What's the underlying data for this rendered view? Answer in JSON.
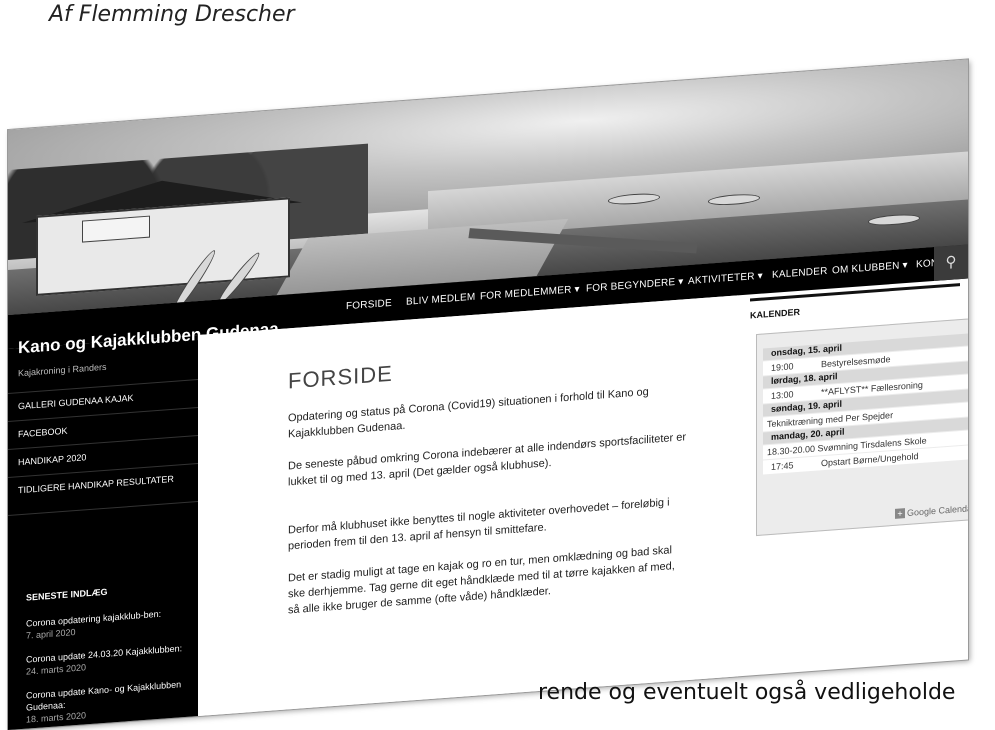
{
  "article": {
    "byline": "Af Flemming Drescher",
    "footer_text": "rende og eventuelt også vedligeholde"
  },
  "site": {
    "title": "Kano og Kajakklubben Gudenaa",
    "tagline": "Kajakroning i Randers"
  },
  "menu": {
    "items": [
      "FORSIDE",
      "BLIV MEDLEM",
      "FOR MEDLEMMER ▾",
      "FOR BEGYNDERE ▾",
      "AKTIVITETER ▾",
      "KALENDER",
      "OM KLUBBEN ▾",
      "KONTAKT"
    ],
    "search_icon": "search-icon"
  },
  "sidebar": {
    "links": [
      "GALLERI GUDENAA KAJAK",
      "FACEBOOK",
      "HANDIKAP 2020",
      "TIDLIGERE HANDIKAP RESULTATER"
    ],
    "recent_heading": "SENESTE INDLÆG",
    "recent_posts": [
      {
        "title": "Corona opdatering kajakklub-ben:",
        "date": "7. april 2020"
      },
      {
        "title": "Corona update 24.03.20 Kajakklubben:",
        "date": "24. marts 2020"
      },
      {
        "title": "Corona update Kano- og Kajakklubben Gudenaa:",
        "date": "18. marts 2020"
      }
    ]
  },
  "main": {
    "title": "FORSIDE",
    "paragraphs": [
      "Opdatering og status på Corona (Covid19) situationen i forhold til Kano og Kajakklubben Gudenaa.",
      "De seneste påbud omkring Corona indebærer at alle indendørs sportsfaciliteter er lukket til og med 13. april (Det gælder også klubhuse).",
      "Derfor må klubhuset ikke benyttes til nogle aktiviteter overhovedet – foreløbig i perioden frem til den 13. april af hensyn til smittefare.",
      "Det er stadig muligt at tage en kajak og ro en tur, men omklædning og bad skal ske derhjemme. Tag gerne dit eget håndklæde med til at tørre kajakken af med, så alle ikke bruger de samme (ofte våde) håndklæder."
    ]
  },
  "calendar": {
    "label": "KALENDER",
    "days": [
      {
        "day": "onsdag, 15. april",
        "events": [
          {
            "time": "19:00",
            "title": "Bestyrelsesmøde"
          }
        ]
      },
      {
        "day": "lørdag, 18. april",
        "events": [
          {
            "time": "13:00",
            "title": "**AFLYST** Fællesroning"
          }
        ]
      },
      {
        "day": "søndag, 19. april",
        "events": [
          {
            "time": "",
            "title": "Tekniktræning med Per Spejder"
          }
        ]
      },
      {
        "day": "mandag, 20. april",
        "events": [
          {
            "time": "",
            "title": "18.30-20.00 Svømning Tirsdalens Skole"
          },
          {
            "time": "17:45",
            "title": "Opstart Børne/Ungehold"
          }
        ]
      }
    ],
    "google_label": "Google Calendar"
  }
}
